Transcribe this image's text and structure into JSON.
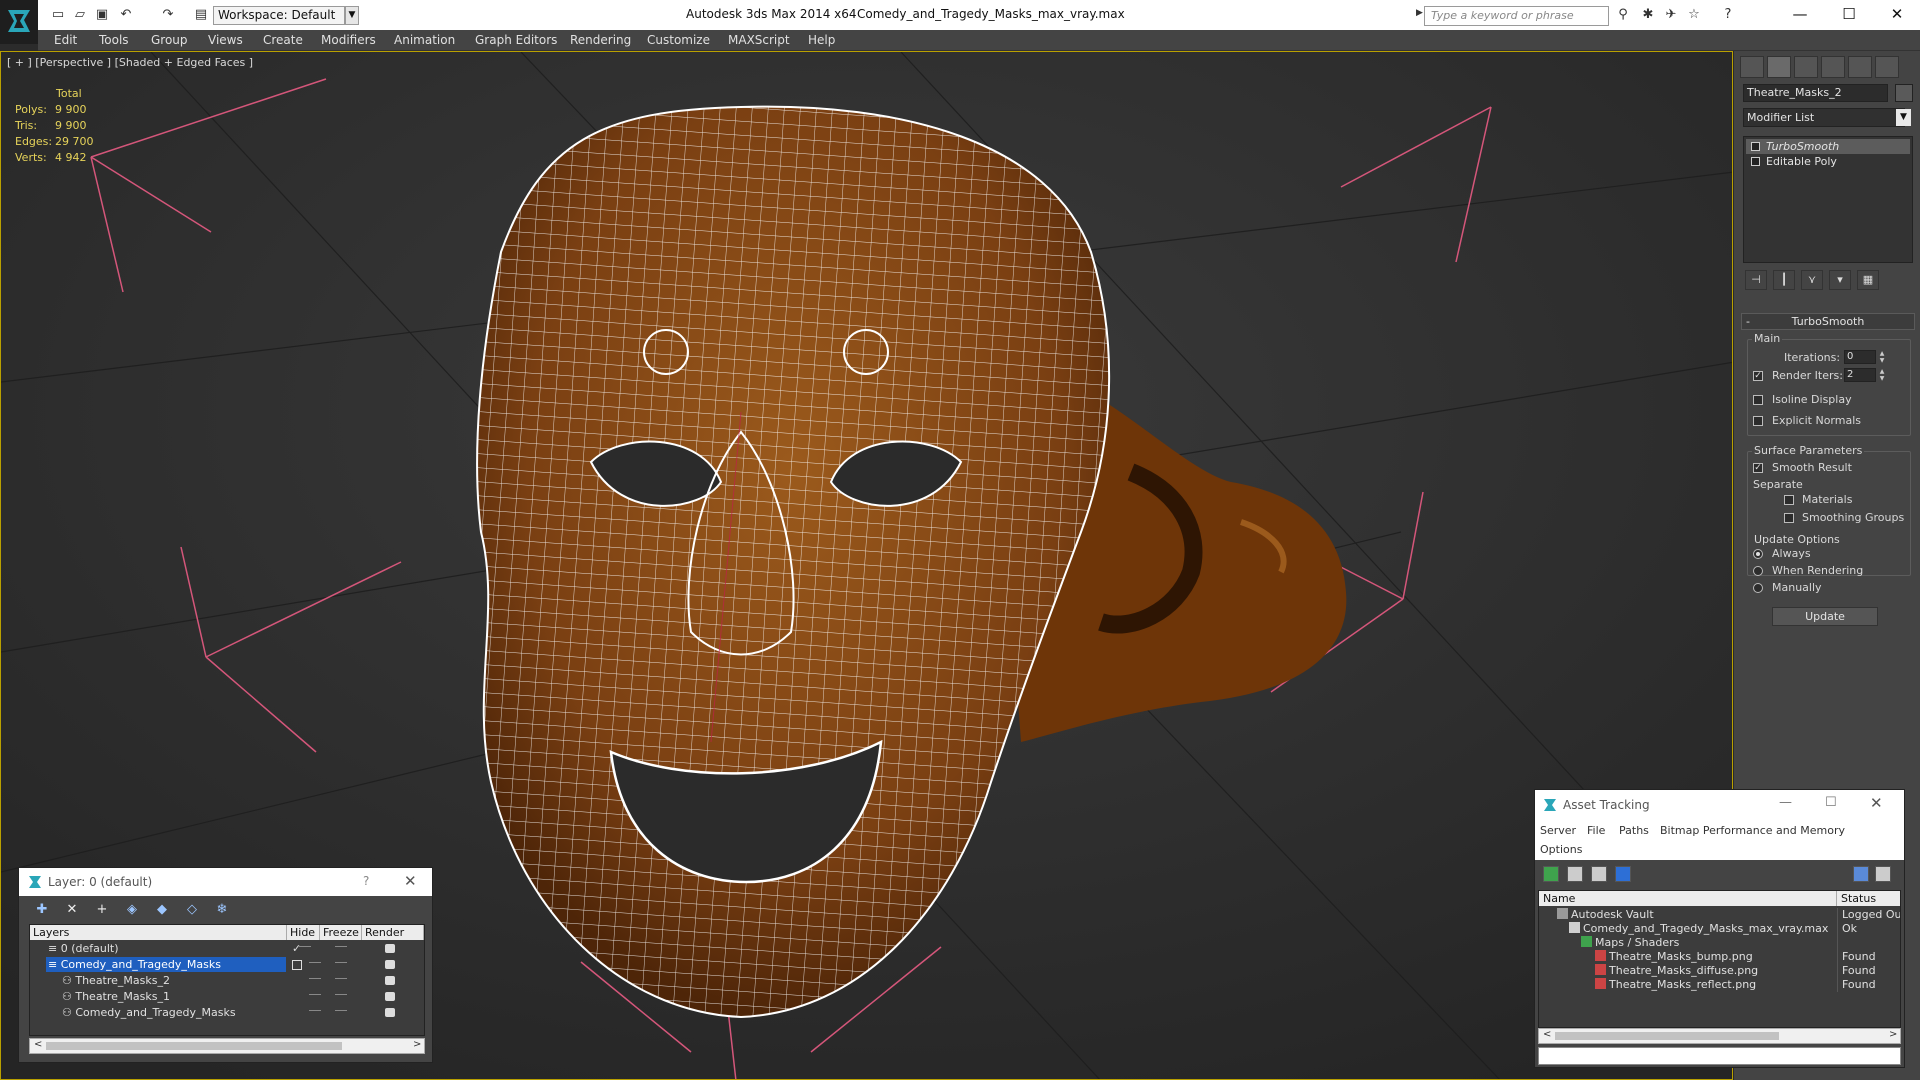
{
  "titlebar": {
    "workspace": "Workspace: Default",
    "app_title": "Autodesk 3ds Max  2014 x64",
    "file_title": "Comedy_and_Tragedy_Masks_max_vray.max",
    "search_placeholder": "Type a keyword or phrase"
  },
  "menu": [
    "Edit",
    "Tools",
    "Group",
    "Views",
    "Create",
    "Modifiers",
    "Animation",
    "Graph Editors",
    "Rendering",
    "Customize",
    "MAXScript",
    "Help"
  ],
  "viewport": {
    "label": "[ + ] [Perspective ] [Shaded + Edged Faces ]",
    "stats_header": "Total",
    "stats": [
      {
        "label": "Polys:",
        "value": "9 900"
      },
      {
        "label": "Tris:",
        "value": "9 900"
      },
      {
        "label": "Edges:",
        "value": "29 700"
      },
      {
        "label": "Verts:",
        "value": "4 942"
      }
    ]
  },
  "command_panel": {
    "object_name": "Theatre_Masks_2",
    "modifier_list": "Modifier List",
    "stack": [
      "TurboSmooth",
      "Editable Poly"
    ],
    "rollout_title": "TurboSmooth",
    "main_label": "Main",
    "iterations_label": "Iterations:",
    "iterations_value": "0",
    "render_iters_label": "Render Iters:",
    "render_iters_value": "2",
    "isoline_display": "Isoline Display",
    "explicit_normals": "Explicit Normals",
    "surface_parameters": "Surface Parameters",
    "smooth_result": "Smooth Result",
    "separate": "Separate",
    "materials": "Materials",
    "smoothing_groups": "Smoothing Groups",
    "update_options": "Update Options",
    "always": "Always",
    "when_rendering": "When Rendering",
    "manually": "Manually",
    "update_button": "Update"
  },
  "layer_window": {
    "title": "Layer: 0 (default)",
    "help": "?",
    "columns": [
      "Layers",
      "Hide",
      "Freeze",
      "Render"
    ],
    "rows": [
      {
        "name": "0 (default)",
        "indent": 0,
        "selected": false
      },
      {
        "name": "Comedy_and_Tragedy_Masks",
        "indent": 0,
        "selected": true
      },
      {
        "name": "Theatre_Masks_2",
        "indent": 1,
        "selected": false
      },
      {
        "name": "Theatre_Masks_1",
        "indent": 1,
        "selected": false
      },
      {
        "name": "Comedy_and_Tragedy_Masks",
        "indent": 1,
        "selected": false
      }
    ]
  },
  "asset_tracking": {
    "title": "Asset Tracking",
    "menu": [
      "Server",
      "File",
      "Paths",
      "Bitmap Performance and Memory",
      "Options"
    ],
    "columns": [
      "Name",
      "Status"
    ],
    "rows": [
      {
        "name": "Autodesk Vault",
        "status": "Logged Ou",
        "level": 0
      },
      {
        "name": "Comedy_and_Tragedy_Masks_max_vray.max",
        "status": "Ok",
        "level": 1
      },
      {
        "name": "Maps / Shaders",
        "status": "",
        "level": 2
      },
      {
        "name": "Theatre_Masks_bump.png",
        "status": "Found",
        "level": 3
      },
      {
        "name": "Theatre_Masks_diffuse.png",
        "status": "Found",
        "level": 3
      },
      {
        "name": "Theatre_Masks_reflect.png",
        "status": "Found",
        "level": 3
      }
    ]
  },
  "colors": {
    "viewport_border": "#b9a000",
    "stats_text": "#e6d35a",
    "mask_brown": "#7a3f12",
    "wire": "#ffffff",
    "gizmo_pink": "#d4567a",
    "selection_blue": "#1f5fbf"
  }
}
